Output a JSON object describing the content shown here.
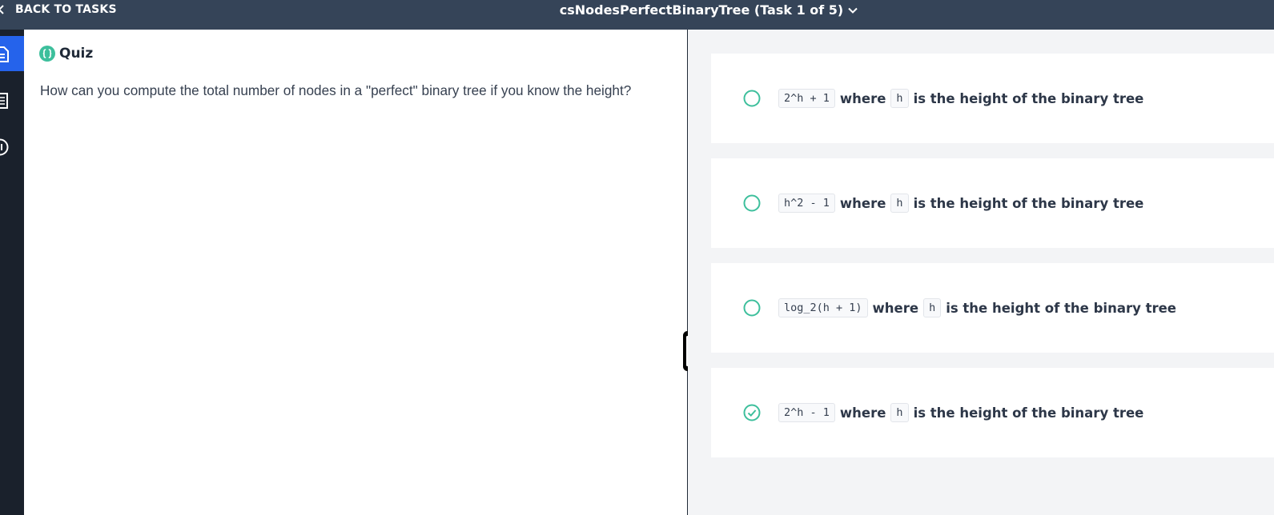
{
  "header": {
    "back_label": "BACK TO TASKS",
    "task_title": "csNodesPerfectBinaryTree (Task 1 of 5)"
  },
  "sidebar": {
    "items": [
      {
        "icon": "document-icon",
        "active": true
      },
      {
        "icon": "list-icon",
        "active": false
      },
      {
        "icon": "info-icon",
        "active": false
      }
    ]
  },
  "quiz": {
    "title": "Quiz",
    "question": "How can you compute the total number of nodes in a \"perfect\" binary tree if you know the height?"
  },
  "options": [
    {
      "formula": "2^h + 1",
      "where": "where",
      "var": "h",
      "rest": "is the height of the binary tree",
      "checked": false
    },
    {
      "formula": "h^2 - 1",
      "where": "where",
      "var": "h",
      "rest": "is the height of the binary tree",
      "checked": false
    },
    {
      "formula": "log_2(h + 1)",
      "where": "where",
      "var": "h",
      "rest": "is the height of the binary tree",
      "checked": false
    },
    {
      "formula": "2^h - 1",
      "where": "where",
      "var": "h",
      "rest": "is the height of the binary tree",
      "checked": true
    }
  ],
  "colors": {
    "header_bg": "#354458",
    "sidebar_bg": "#1a212c",
    "sidebar_active": "#2563eb",
    "accent": "#3dbf9c",
    "right_pane_bg": "#f3f4f6"
  }
}
